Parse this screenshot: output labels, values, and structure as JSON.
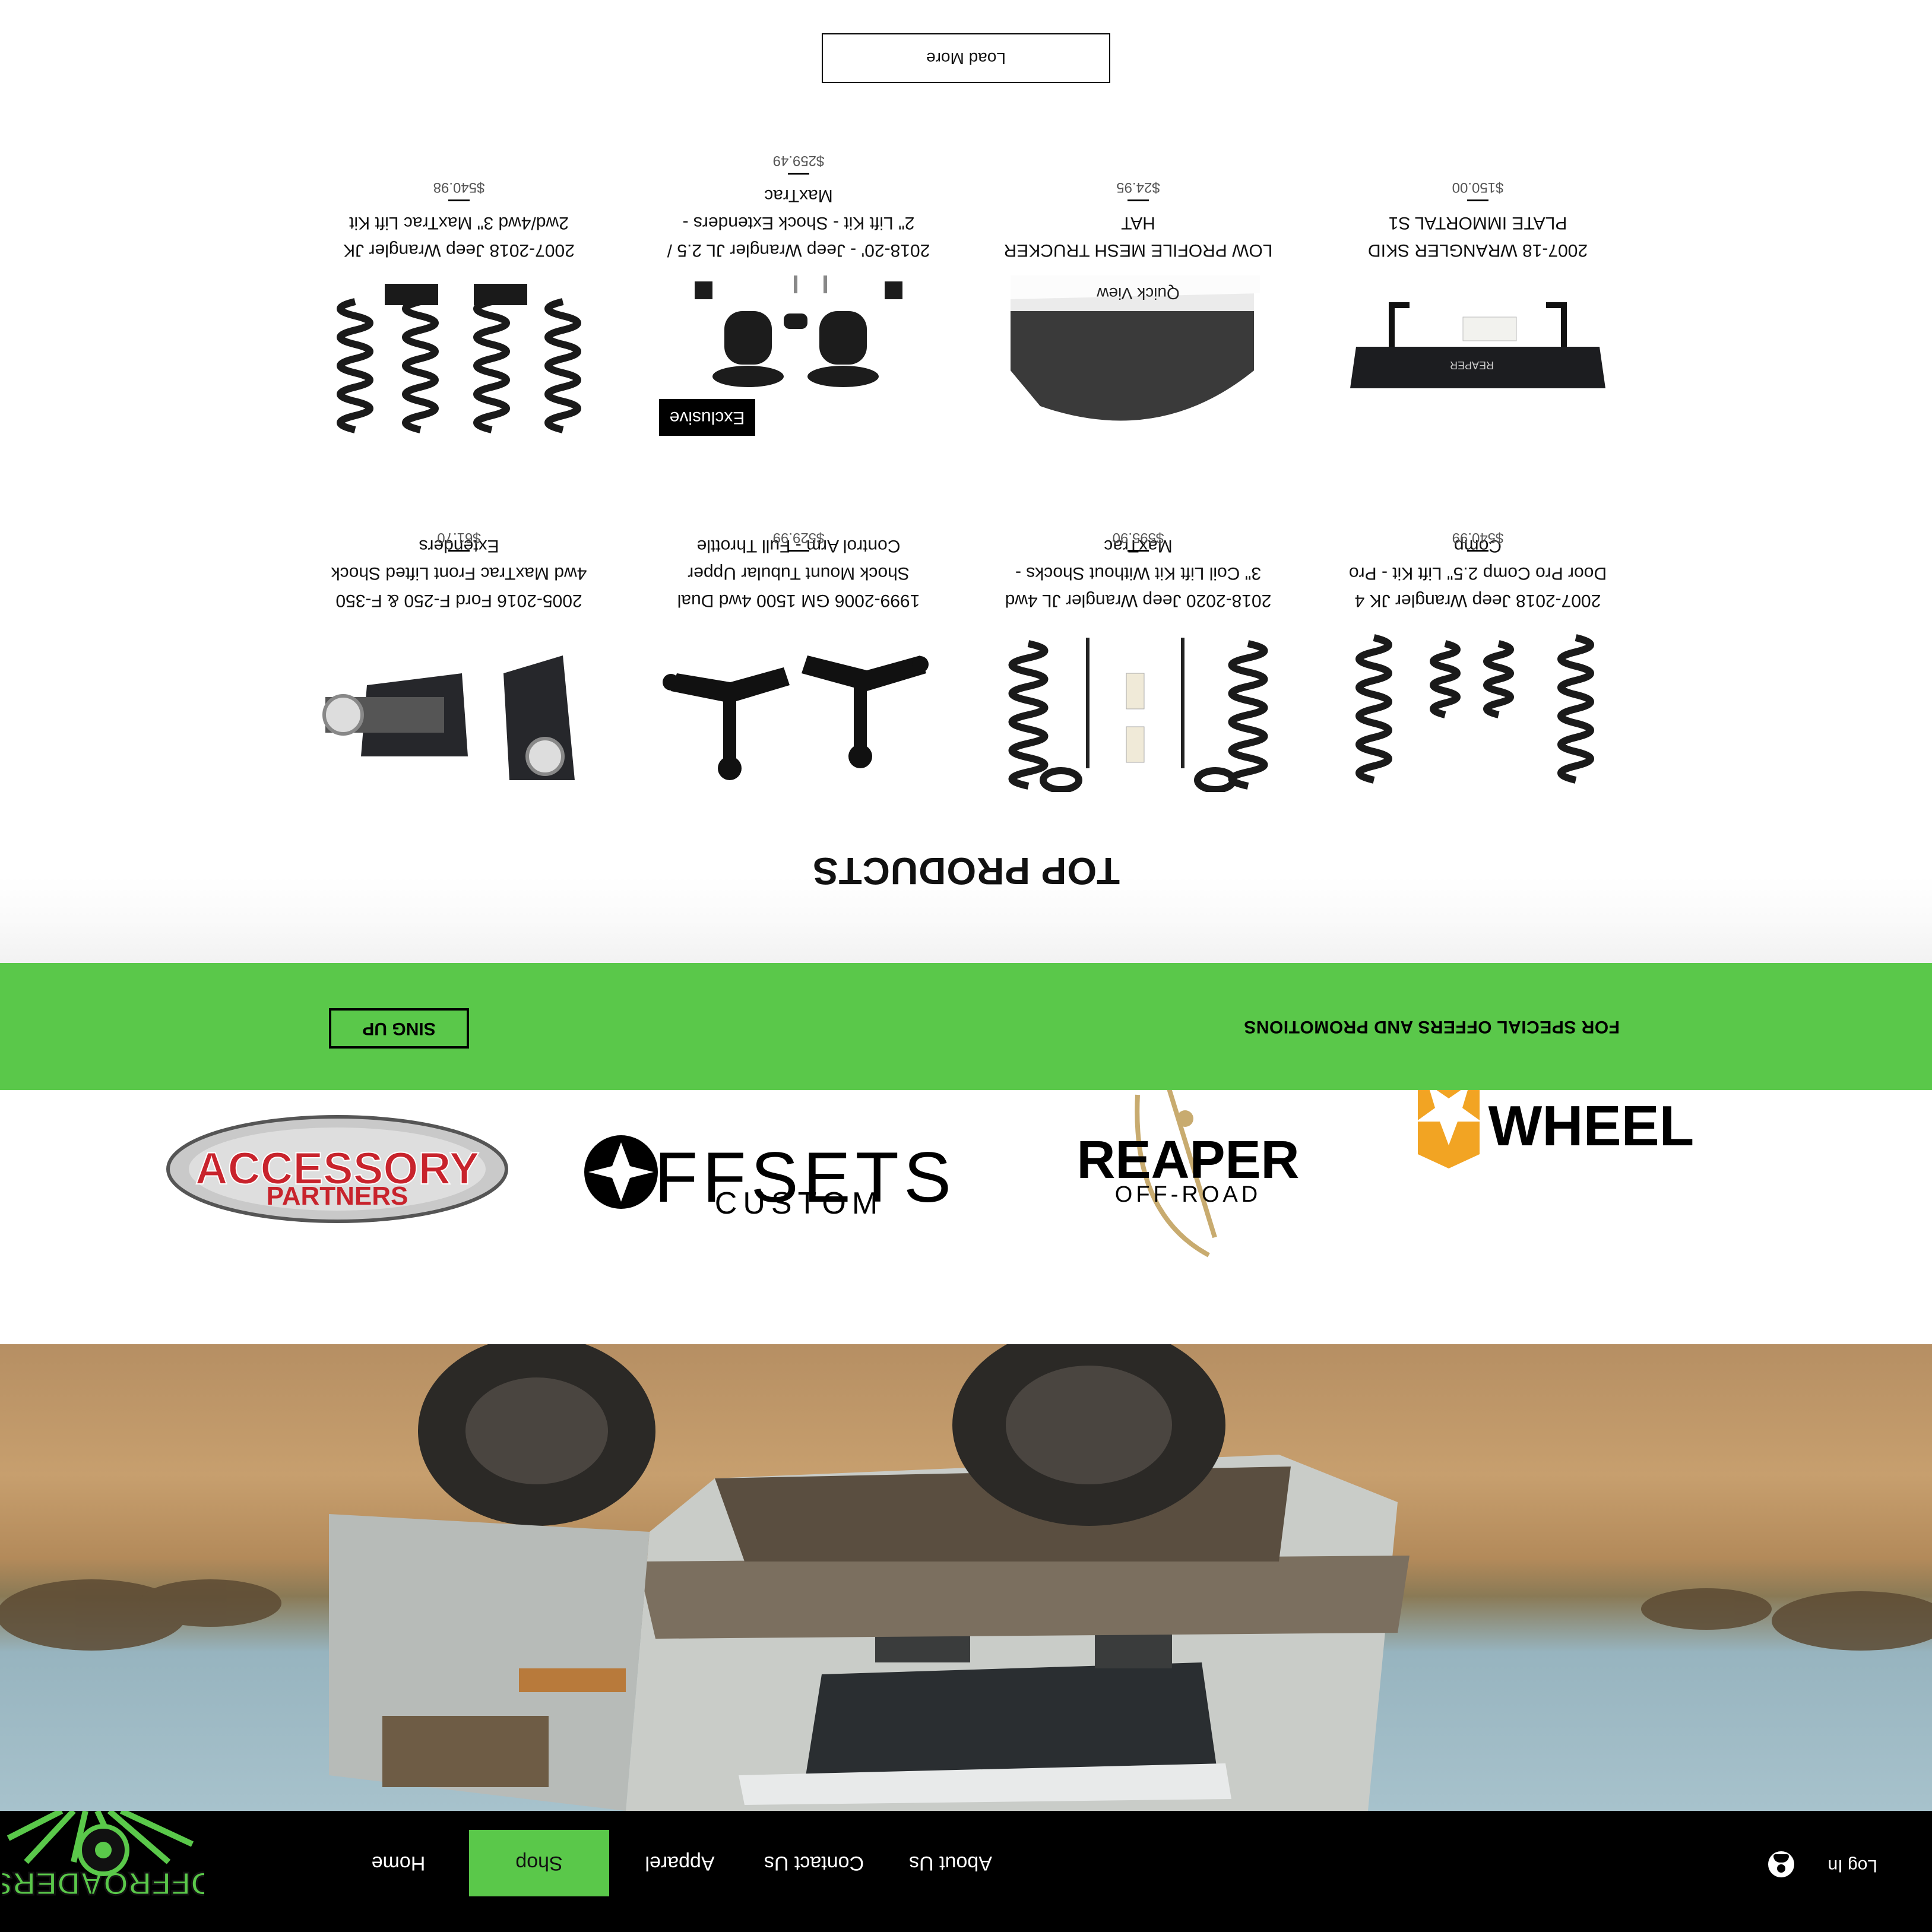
{
  "nav": {
    "logo_text": "OFFROADERS",
    "items": [
      {
        "label": "Home"
      },
      {
        "label": "Shop",
        "active": true
      },
      {
        "label": "Apparel"
      },
      {
        "label": "Contact Us"
      },
      {
        "label": "About Us"
      }
    ],
    "login_label": "Log In",
    "login_icon": "user-avatar-icon"
  },
  "brands": [
    {
      "name": "Accessory Partners",
      "line1": "ACCESSORY",
      "line2": "PARTNERS"
    },
    {
      "name": "Offsets Custom",
      "line1": "FFSETS",
      "line2": "CUSTOM"
    },
    {
      "name": "Reaper Off-Road",
      "line1": "REAPER",
      "line2": "OFF-ROAD"
    },
    {
      "name": "Wheel",
      "line1": "WHEEL"
    }
  ],
  "promo": {
    "text": "FOR SPECIAL OFFERS AND PROMOTIONS",
    "button": "SING UP"
  },
  "section_title": "TOP PRODUCTS",
  "products": [
    {
      "title": "2007-2018 Jeep Wrangler JK 4 Door Pro Comp 2.5\" Lift Kit - Pro Comp",
      "price": "$540.99"
    },
    {
      "title": "2018-2020 Jeep Wrangler JL 4wd 3\" Coil Lift Kit Without Shocks - MaxTrac",
      "price": "$595.90"
    },
    {
      "title": "1999-2006 GM 1500 4wd Dual Shock Mount Tubular Upper Control Arm - Full Throttle",
      "price": "$529.99"
    },
    {
      "title": "2005-2016 Ford F-250 & F-350 4wd MaxTrac Front Lifted Shock Extenders",
      "price": "$61.70"
    },
    {
      "title": "2007-18 WRANGLER SKID PLATE IMMORTAL S1",
      "price": "$150.00"
    },
    {
      "title": "LOW PROFILE MESH TRUCKER HAT",
      "price": "$24.95",
      "quick_view": "Quick View"
    },
    {
      "title": "2018-20' - Jeep Wrangler JL 2.5 / 2\" Lift Kit - Shock Extenders - MaxTrac",
      "price": "$259.49",
      "badge": "Exclusive"
    },
    {
      "title": "2007-2018 Jeep Wrangler JK 2wd/4wd 3\" MaxTrac Lift Kit",
      "price": "$540.98"
    }
  ],
  "load_more": "Load More"
}
